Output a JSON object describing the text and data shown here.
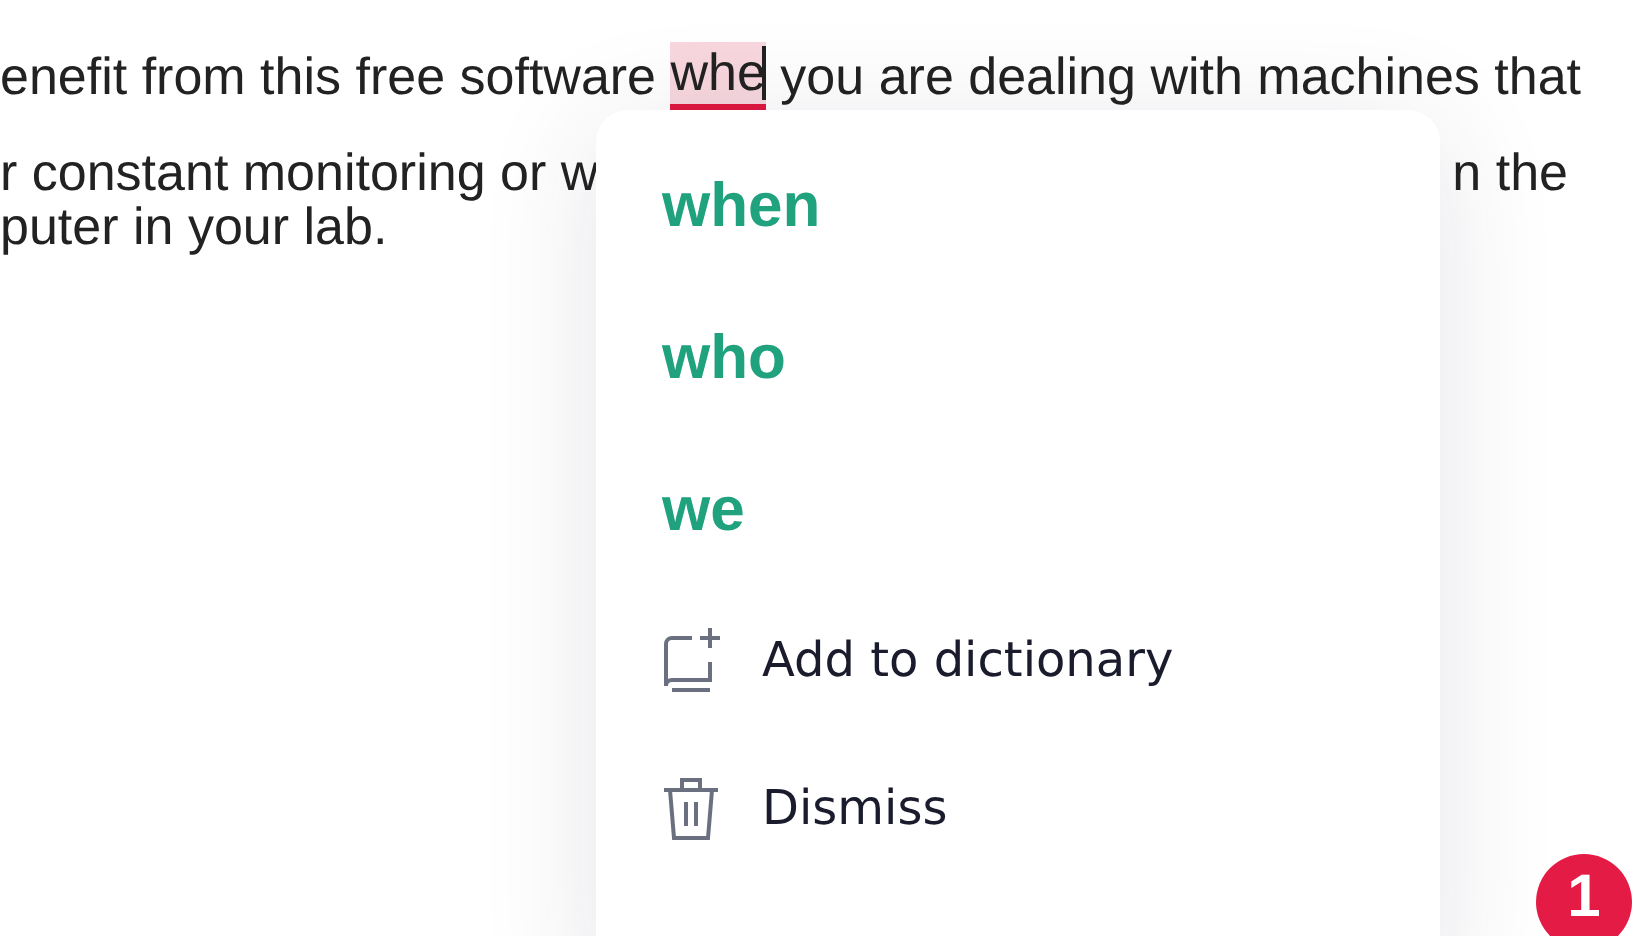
{
  "document": {
    "line_1": {
      "before": "enefit from this free software ",
      "flagged_word": "whe",
      "after": " you are dealing with machines that"
    },
    "line_2": {
      "left": "r constant monitoring or w",
      "right": "n the"
    },
    "line_3": "puter in your lab."
  },
  "popup": {
    "suggestions": [
      "when",
      "who",
      "we"
    ],
    "actions": [
      {
        "kind": "add",
        "label": "Add to dictionary"
      },
      {
        "kind": "dismiss",
        "label": "Dismiss"
      }
    ]
  },
  "badge": {
    "count": "1"
  }
}
